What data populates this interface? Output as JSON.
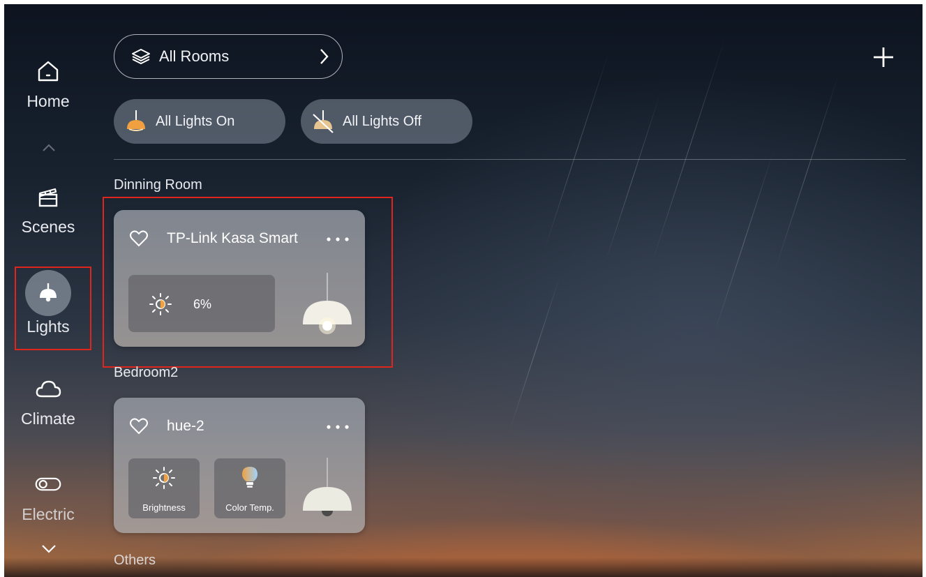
{
  "sidebar": {
    "items": [
      {
        "label": "Home",
        "icon": "home-icon"
      },
      {
        "label": "Scenes",
        "icon": "clapperboard-icon"
      },
      {
        "label": "Lights",
        "icon": "ceiling-lamp-icon",
        "selected": true
      },
      {
        "label": "Climate",
        "icon": "cloud-icon"
      },
      {
        "label": "Electric",
        "icon": "toggle-switch-icon"
      }
    ],
    "scroll_up_icon": "chevron-up-icon",
    "scroll_down_icon": "chevron-down-icon"
  },
  "header": {
    "room_selector": {
      "label": "All Rooms",
      "icon": "layers-icon",
      "arrow": "chevron-right-icon"
    },
    "add_icon": "plus-icon"
  },
  "actions": {
    "all_on": {
      "label": "All Lights On",
      "icon": "lamp-on-icon"
    },
    "all_off": {
      "label": "All Lights Off",
      "icon": "lamp-off-icon"
    }
  },
  "sections": [
    {
      "title": "Dinning Room",
      "devices": [
        {
          "name": "TP-Link Kasa Smart",
          "brightness": "6%",
          "lamp_on": true
        }
      ]
    },
    {
      "title": "Bedroom2",
      "devices": [
        {
          "name": "hue-2",
          "controls": [
            "Brightness",
            "Color Temp."
          ],
          "lamp_on": false
        }
      ]
    },
    {
      "title": "Others"
    }
  ],
  "colors": {
    "highlight": "#e0261c",
    "accent_orange": "#f0a040"
  }
}
